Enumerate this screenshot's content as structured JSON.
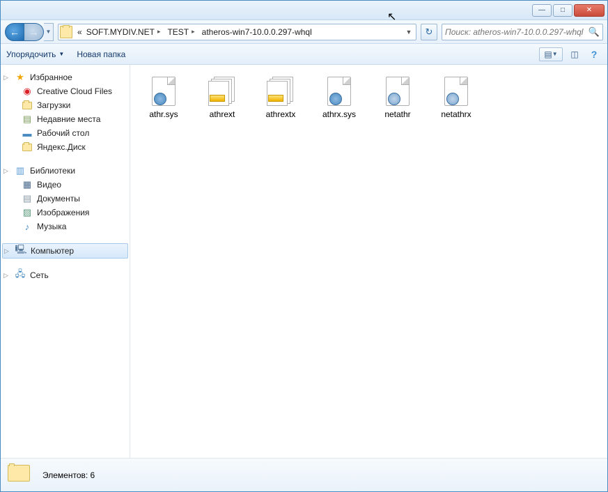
{
  "window_controls": {
    "min": "—",
    "max": "□",
    "close": "✕"
  },
  "breadcrumbs": {
    "prefix": "«",
    "items": [
      "SOFT.MYDIV.NET",
      "TEST",
      "atheros-win7-10.0.0.297-whql"
    ]
  },
  "search": {
    "placeholder": "Поиск: atheros-win7-10.0.0.297-whql"
  },
  "toolbar": {
    "organize": "Упорядочить",
    "new_folder": "Новая папка"
  },
  "sidebar": {
    "favorites": {
      "label": "Избранное",
      "items": [
        {
          "label": "Creative Cloud Files",
          "icon": "cc"
        },
        {
          "label": "Загрузки",
          "icon": "folder"
        },
        {
          "label": "Недавние места",
          "icon": "recent"
        },
        {
          "label": "Рабочий стол",
          "icon": "desktop"
        },
        {
          "label": "Яндекс.Диск",
          "icon": "folder"
        }
      ]
    },
    "libraries": {
      "label": "Библиотеки",
      "items": [
        {
          "label": "Видео",
          "icon": "video"
        },
        {
          "label": "Документы",
          "icon": "doc"
        },
        {
          "label": "Изображения",
          "icon": "img"
        },
        {
          "label": "Музыка",
          "icon": "music"
        }
      ]
    },
    "computer": {
      "label": "Компьютер"
    },
    "network": {
      "label": "Сеть"
    }
  },
  "files": [
    {
      "name": "athr.sys",
      "type": "sys"
    },
    {
      "name": "athrext",
      "type": "cat"
    },
    {
      "name": "athrextx",
      "type": "cat"
    },
    {
      "name": "athrx.sys",
      "type": "sys"
    },
    {
      "name": "netathr",
      "type": "inf"
    },
    {
      "name": "netathrx",
      "type": "inf"
    }
  ],
  "status": {
    "label": "Элементов: 6"
  }
}
